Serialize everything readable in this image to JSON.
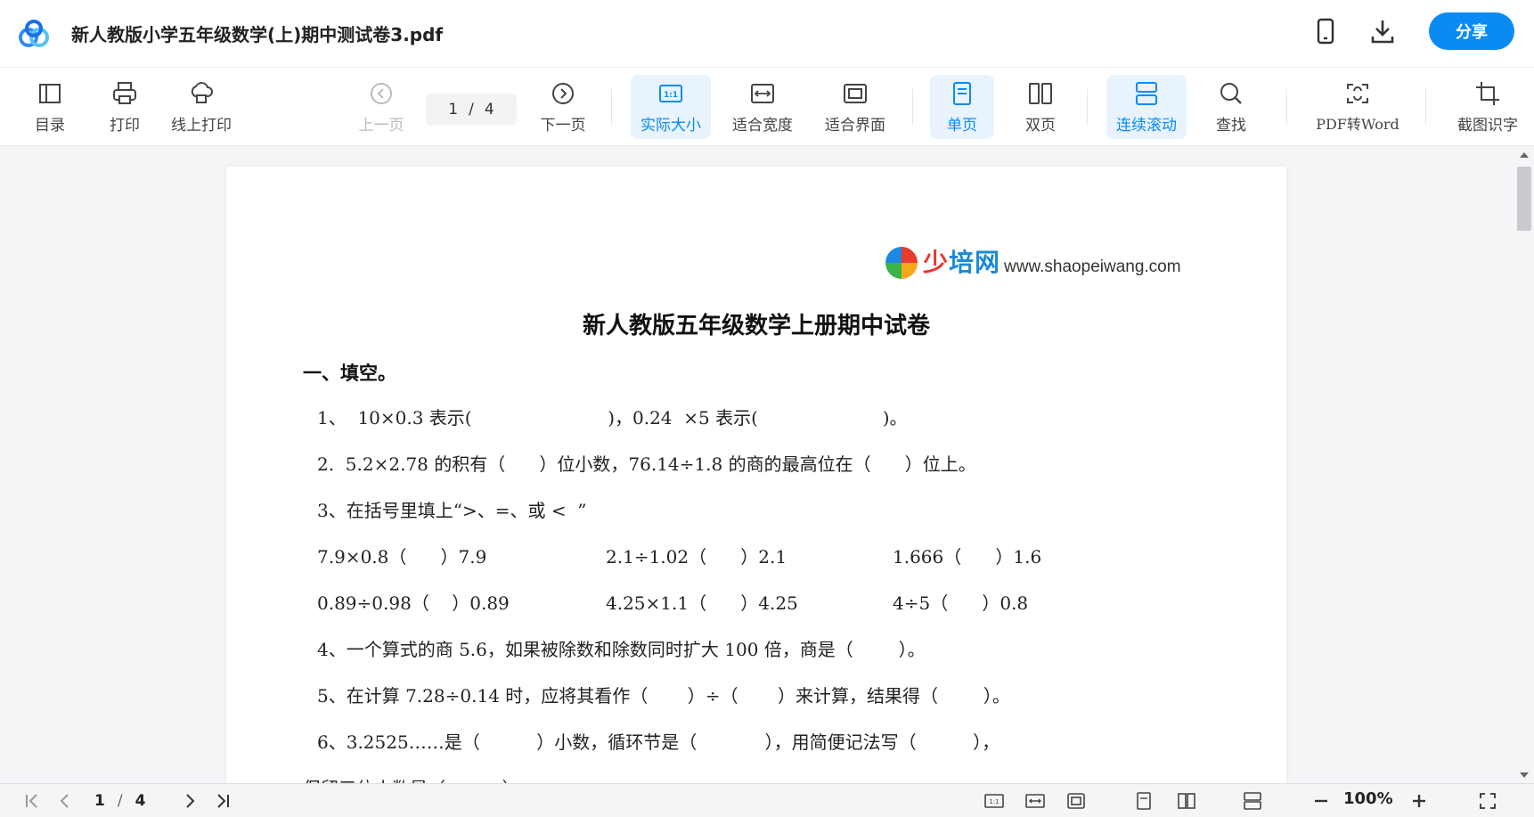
{
  "app": {
    "doc_title": "新人教版小学五年级数学(上)期中测试卷3.pdf",
    "share_label": "分享"
  },
  "toolbar": {
    "toc": "目录",
    "print": "打印",
    "online_print": "线上打印",
    "prev_page": "上一页",
    "page_current": "1",
    "page_sep": "/",
    "page_total": "4",
    "next_page": "下一页",
    "actual_size": "实际大小",
    "fit_width": "适合宽度",
    "fit_page": "适合界面",
    "single_page": "单页",
    "double_page": "双页",
    "continuous_scroll": "连续滚动",
    "find": "查找",
    "pdf_to_word": "PDF转Word",
    "ocr": "截图识字",
    "actual_size_badge": "1:1"
  },
  "document": {
    "brand_cn_1": "少",
    "brand_cn_2": "培网",
    "brand_url": "www.shaopeiwang.com",
    "title": "新人教版五年级数学上册期中试卷",
    "section": "一、填空。",
    "q1": "1、  10×0.3 表示(                        )，0.24  ×5 表示(                      )。",
    "q2": "2.  5.2×2.78 的积有（      ）位小数，76.14÷1.8 的商的最高位在（      ）位上。",
    "q3": "3、在括号里填上“>、=、或 <  ”",
    "q3_row1": [
      "7.9×0.8（      ）7.9",
      "2.1÷1.02（      ）2.1",
      "1.666（      ）1.6"
    ],
    "q3_row2": [
      "0.89÷0.98（    ）0.89",
      "4.25×1.1（      ）4.25",
      "4÷5（      ）0.8"
    ],
    "q4": "4、一个算式的商 5.6，如果被除数和除数同时扩大 100 倍，商是（        ）。",
    "q5": "5、在计算 7.28÷0.14 时，应将其看作（       ）÷（       ）来计算，结果得（        ）。",
    "q6": "6、3.2525……是（          ）小数，循环节是（            ），用简便记法写（          ），",
    "q6_cont": "保留三位小数是（          ）"
  },
  "statusbar": {
    "page_current": "1",
    "page_sep": "/",
    "page_total": "4",
    "zoom": "100%"
  },
  "colors": {
    "accent": "#0a8bf4",
    "active_bg": "#e8f3fe"
  }
}
